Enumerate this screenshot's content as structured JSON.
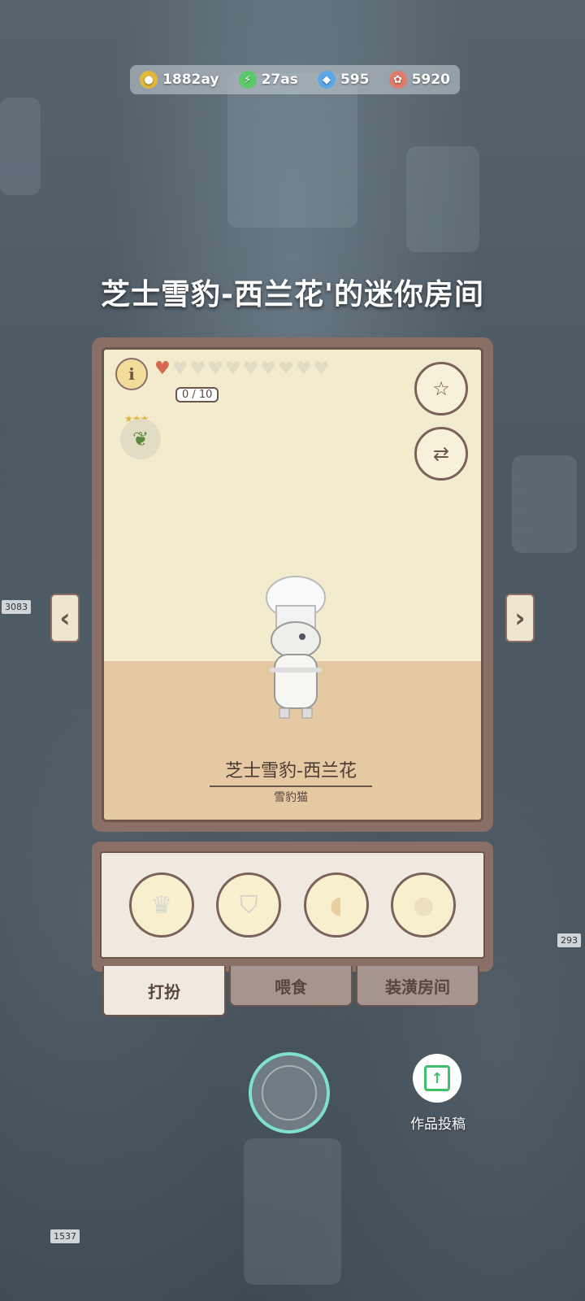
{
  "resources": [
    {
      "icon": "coin-icon",
      "value": "1882ay",
      "color": "#e2b83b"
    },
    {
      "icon": "energy-icon",
      "value": "27as",
      "color": "#5bc86a"
    },
    {
      "icon": "diamond-icon",
      "value": "595",
      "color": "#5aa8e8"
    },
    {
      "icon": "gem-icon",
      "value": "5920",
      "color": "#e07a6b"
    }
  ],
  "room_title": "芝士雪豹-西兰花'的迷你房间",
  "hearts": {
    "filled": 1,
    "total": 10,
    "count_label": "0 / 10"
  },
  "pet": {
    "name": "芝士雪豹-西兰花",
    "breed": "雪豹猫"
  },
  "slots": [
    "chef-hat-icon",
    "vest-icon",
    "scarf-icon",
    "cat-silhouette-icon"
  ],
  "tabs": [
    "打扮",
    "喂食",
    "装潢房间"
  ],
  "submit_label": "作品投稿",
  "colors": {
    "card_border": "#8a6f66",
    "wall": "#f3ebcd",
    "floor": "#e4c9a2",
    "accent_ring": "#7fe0d1"
  }
}
